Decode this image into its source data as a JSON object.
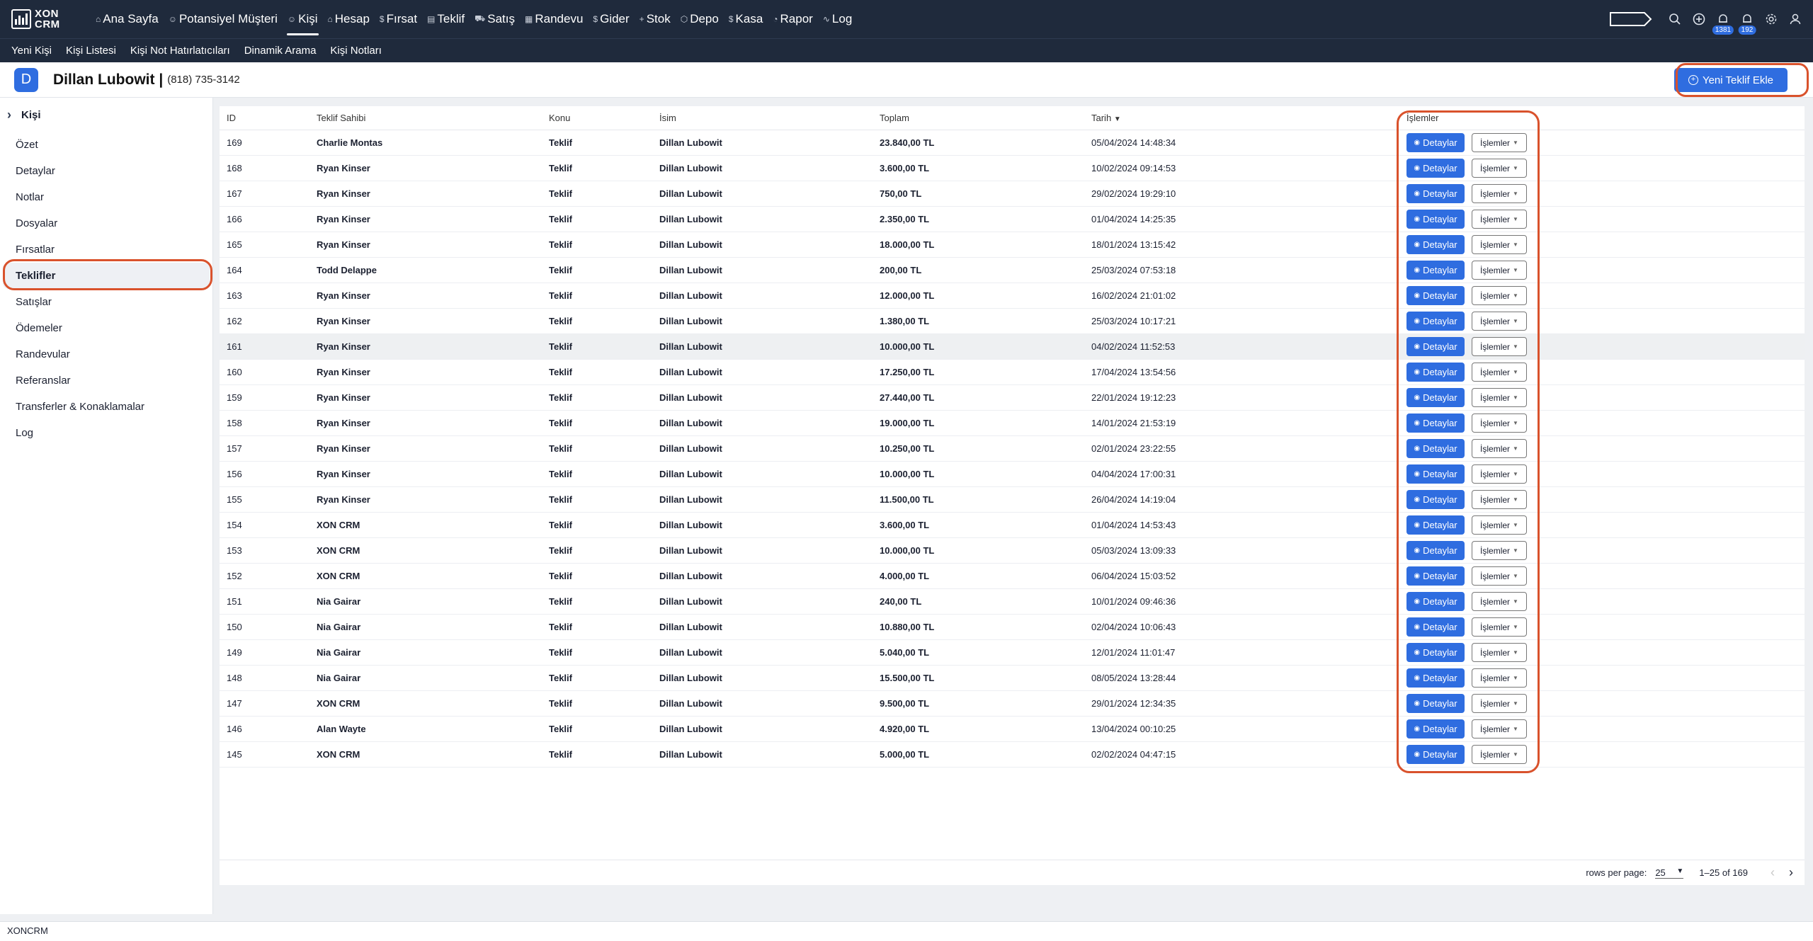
{
  "brand": {
    "name_line1": "XON",
    "name_line2": "CRM"
  },
  "topnav": {
    "items": [
      {
        "label": "Ana Sayfa",
        "icon": "⌂"
      },
      {
        "label": "Potansiyel Müşteri",
        "icon": "☺"
      },
      {
        "label": "Kişi",
        "icon": "☺"
      },
      {
        "label": "Hesap",
        "icon": "⌂"
      },
      {
        "label": "Fırsat",
        "icon": "$"
      },
      {
        "label": "Teklif",
        "icon": "▤"
      },
      {
        "label": "Satış",
        "icon": "⛟"
      },
      {
        "label": "Randevu",
        "icon": "▦"
      },
      {
        "label": "Gider",
        "icon": "$"
      },
      {
        "label": "Stok",
        "icon": "+"
      },
      {
        "label": "Depo",
        "icon": "⬡"
      },
      {
        "label": "Kasa",
        "icon": "$"
      },
      {
        "label": "Rapor",
        "icon": "◔"
      },
      {
        "label": "Log",
        "icon": "∿"
      }
    ],
    "active": "Kişi",
    "badges": {
      "notifications_1": "1381",
      "notifications_2": "192"
    }
  },
  "subnav": {
    "items": [
      "Yeni Kişi",
      "Kişi Listesi",
      "Kişi Not Hatırlatıcıları",
      "Dinamik Arama",
      "Kişi Notları"
    ]
  },
  "header": {
    "avatar_letter": "D",
    "contact_name": "Dillan Lubowit |",
    "phone": "(818) 735-3142",
    "add_button": "Yeni Teklif Ekle"
  },
  "sidebar": {
    "heading": "Kişi",
    "items": [
      "Özet",
      "Detaylar",
      "Notlar",
      "Dosyalar",
      "Fırsatlar",
      "Teklifler",
      "Satışlar",
      "Ödemeler",
      "Randevular",
      "Referanslar",
      "Transferler & Konaklamalar",
      "Log"
    ],
    "active": "Teklifler"
  },
  "table": {
    "columns": {
      "id": "ID",
      "owner": "Teklif Sahibi",
      "topic": "Konu",
      "name": "İsim",
      "total": "Toplam",
      "date": "Tarih",
      "ops": "İşlemler"
    },
    "sort": {
      "column": "Tarih",
      "direction": "desc"
    },
    "detail_label": "Detaylar",
    "ops_label": "İşlemler",
    "rows": [
      {
        "id": "169",
        "owner": "Charlie Montas",
        "topic": "Teklif",
        "name": "Dillan Lubowit",
        "total": "23.840,00 TL",
        "date": "05/04/2024 14:48:34"
      },
      {
        "id": "168",
        "owner": "Ryan Kinser",
        "topic": "Teklif",
        "name": "Dillan Lubowit",
        "total": "3.600,00 TL",
        "date": "10/02/2024 09:14:53"
      },
      {
        "id": "167",
        "owner": "Ryan Kinser",
        "topic": "Teklif",
        "name": "Dillan Lubowit",
        "total": "750,00 TL",
        "date": "29/02/2024 19:29:10"
      },
      {
        "id": "166",
        "owner": "Ryan Kinser",
        "topic": "Teklif",
        "name": "Dillan Lubowit",
        "total": "2.350,00 TL",
        "date": "01/04/2024 14:25:35"
      },
      {
        "id": "165",
        "owner": "Ryan Kinser",
        "topic": "Teklif",
        "name": "Dillan Lubowit",
        "total": "18.000,00 TL",
        "date": "18/01/2024 13:15:42"
      },
      {
        "id": "164",
        "owner": "Todd Delappe",
        "topic": "Teklif",
        "name": "Dillan Lubowit",
        "total": "200,00 TL",
        "date": "25/03/2024 07:53:18"
      },
      {
        "id": "163",
        "owner": "Ryan Kinser",
        "topic": "Teklif",
        "name": "Dillan Lubowit",
        "total": "12.000,00 TL",
        "date": "16/02/2024 21:01:02"
      },
      {
        "id": "162",
        "owner": "Ryan Kinser",
        "topic": "Teklif",
        "name": "Dillan Lubowit",
        "total": "1.380,00 TL",
        "date": "25/03/2024 10:17:21"
      },
      {
        "id": "161",
        "owner": "Ryan Kinser",
        "topic": "Teklif",
        "name": "Dillan Lubowit",
        "total": "10.000,00 TL",
        "date": "04/02/2024 11:52:53"
      },
      {
        "id": "160",
        "owner": "Ryan Kinser",
        "topic": "Teklif",
        "name": "Dillan Lubowit",
        "total": "17.250,00 TL",
        "date": "17/04/2024 13:54:56"
      },
      {
        "id": "159",
        "owner": "Ryan Kinser",
        "topic": "Teklif",
        "name": "Dillan Lubowit",
        "total": "27.440,00 TL",
        "date": "22/01/2024 19:12:23"
      },
      {
        "id": "158",
        "owner": "Ryan Kinser",
        "topic": "Teklif",
        "name": "Dillan Lubowit",
        "total": "19.000,00 TL",
        "date": "14/01/2024 21:53:19"
      },
      {
        "id": "157",
        "owner": "Ryan Kinser",
        "topic": "Teklif",
        "name": "Dillan Lubowit",
        "total": "10.250,00 TL",
        "date": "02/01/2024 23:22:55"
      },
      {
        "id": "156",
        "owner": "Ryan Kinser",
        "topic": "Teklif",
        "name": "Dillan Lubowit",
        "total": "10.000,00 TL",
        "date": "04/04/2024 17:00:31"
      },
      {
        "id": "155",
        "owner": "Ryan Kinser",
        "topic": "Teklif",
        "name": "Dillan Lubowit",
        "total": "11.500,00 TL",
        "date": "26/04/2024 14:19:04"
      },
      {
        "id": "154",
        "owner": "XON CRM",
        "topic": "Teklif",
        "name": "Dillan Lubowit",
        "total": "3.600,00 TL",
        "date": "01/04/2024 14:53:43"
      },
      {
        "id": "153",
        "owner": "XON CRM",
        "topic": "Teklif",
        "name": "Dillan Lubowit",
        "total": "10.000,00 TL",
        "date": "05/03/2024 13:09:33"
      },
      {
        "id": "152",
        "owner": "XON CRM",
        "topic": "Teklif",
        "name": "Dillan Lubowit",
        "total": "4.000,00 TL",
        "date": "06/04/2024 15:03:52"
      },
      {
        "id": "151",
        "owner": "Nia Gairar",
        "topic": "Teklif",
        "name": "Dillan Lubowit",
        "total": "240,00 TL",
        "date": "10/01/2024 09:46:36"
      },
      {
        "id": "150",
        "owner": "Nia Gairar",
        "topic": "Teklif",
        "name": "Dillan Lubowit",
        "total": "10.880,00 TL",
        "date": "02/04/2024 10:06:43"
      },
      {
        "id": "149",
        "owner": "Nia Gairar",
        "topic": "Teklif",
        "name": "Dillan Lubowit",
        "total": "5.040,00 TL",
        "date": "12/01/2024 11:01:47"
      },
      {
        "id": "148",
        "owner": "Nia Gairar",
        "topic": "Teklif",
        "name": "Dillan Lubowit",
        "total": "15.500,00 TL",
        "date": "08/05/2024 13:28:44"
      },
      {
        "id": "147",
        "owner": "XON CRM",
        "topic": "Teklif",
        "name": "Dillan Lubowit",
        "total": "9.500,00 TL",
        "date": "29/01/2024 12:34:35"
      },
      {
        "id": "146",
        "owner": "Alan Wayte",
        "topic": "Teklif",
        "name": "Dillan Lubowit",
        "total": "4.920,00 TL",
        "date": "13/04/2024 00:10:25"
      },
      {
        "id": "145",
        "owner": "XON CRM",
        "topic": "Teklif",
        "name": "Dillan Lubowit",
        "total": "5.000,00 TL",
        "date": "02/02/2024 04:47:15"
      }
    ],
    "highlighted_row": "161"
  },
  "pager": {
    "rows_per_page_label": "rows per page:",
    "rows_per_page": "25",
    "range": "1–25 of 169"
  },
  "footer": {
    "text": "XONCRM"
  },
  "colors": {
    "nav_bg": "#1f2a3c",
    "accent": "#2f6de0",
    "annotation": "#d9522c"
  }
}
